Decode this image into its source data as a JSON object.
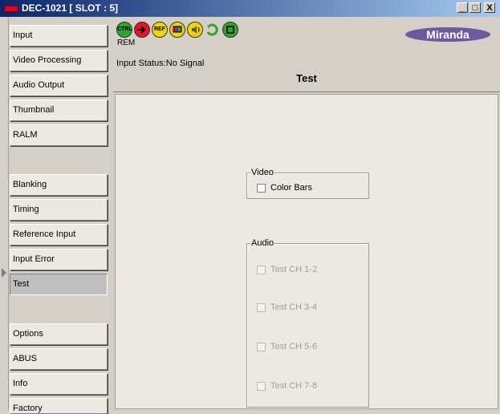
{
  "window": {
    "title": "DEC-1021 [ SLOT : 5]",
    "min": "_",
    "max": "□",
    "close": "X"
  },
  "nav": {
    "items": [
      "Input",
      "Video Processing",
      "Audio Output",
      "Thumbnail",
      "RALM",
      "Blanking",
      "Timing",
      "Reference Input",
      "Input Error",
      "Test",
      "Options",
      "ABUS",
      "Info",
      "Factory"
    ],
    "active": "Test"
  },
  "toolbar": {
    "icons": [
      {
        "name": "ctrl-icon",
        "label": "CTRL",
        "color": "#2fa52f"
      },
      {
        "name": "input-arrow-icon",
        "label": "",
        "color": "#e8102a"
      },
      {
        "name": "ref-icon",
        "label": "REF",
        "color": "#f2d500"
      },
      {
        "name": "video-monitor-icon",
        "label": "",
        "color": "#f2d500"
      },
      {
        "name": "audio-speaker-icon",
        "label": "",
        "color": "#f2d500"
      },
      {
        "name": "loop-arrow-icon",
        "label": "",
        "color": "#2fa52f"
      },
      {
        "name": "status-green-icon",
        "label": "",
        "color": "#2fa52f"
      }
    ],
    "rem": "REM",
    "logo": "Miranda"
  },
  "status": "Input Status:No Signal",
  "heading": "Test",
  "video": {
    "legend": "Video",
    "options": [
      "Color Bars"
    ]
  },
  "audio": {
    "legend": "Audio",
    "options": [
      "Test CH 1-2",
      "Test CH 3-4",
      "Test CH 5-6",
      "Test CH 7-8"
    ]
  }
}
